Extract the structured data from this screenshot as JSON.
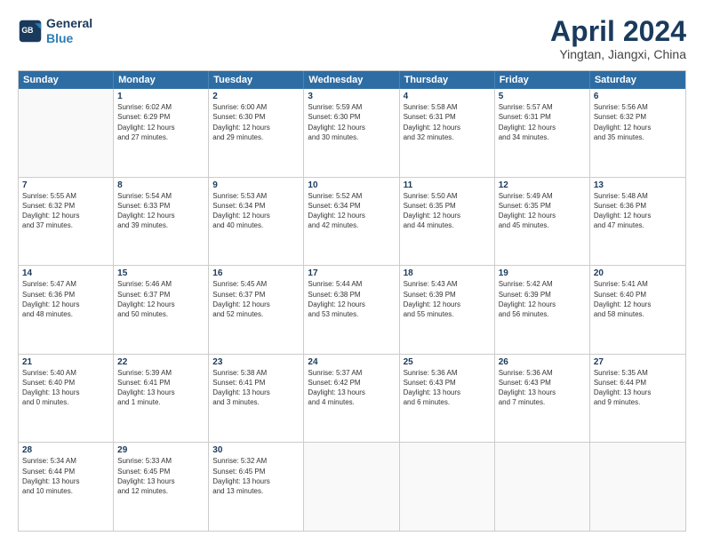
{
  "logo": {
    "line1": "General",
    "line2": "Blue"
  },
  "title": "April 2024",
  "subtitle": "Yingtan, Jiangxi, China",
  "header_days": [
    "Sunday",
    "Monday",
    "Tuesday",
    "Wednesday",
    "Thursday",
    "Friday",
    "Saturday"
  ],
  "weeks": [
    [
      {
        "day": "",
        "info": ""
      },
      {
        "day": "1",
        "info": "Sunrise: 6:02 AM\nSunset: 6:29 PM\nDaylight: 12 hours\nand 27 minutes."
      },
      {
        "day": "2",
        "info": "Sunrise: 6:00 AM\nSunset: 6:30 PM\nDaylight: 12 hours\nand 29 minutes."
      },
      {
        "day": "3",
        "info": "Sunrise: 5:59 AM\nSunset: 6:30 PM\nDaylight: 12 hours\nand 30 minutes."
      },
      {
        "day": "4",
        "info": "Sunrise: 5:58 AM\nSunset: 6:31 PM\nDaylight: 12 hours\nand 32 minutes."
      },
      {
        "day": "5",
        "info": "Sunrise: 5:57 AM\nSunset: 6:31 PM\nDaylight: 12 hours\nand 34 minutes."
      },
      {
        "day": "6",
        "info": "Sunrise: 5:56 AM\nSunset: 6:32 PM\nDaylight: 12 hours\nand 35 minutes."
      }
    ],
    [
      {
        "day": "7",
        "info": "Sunrise: 5:55 AM\nSunset: 6:32 PM\nDaylight: 12 hours\nand 37 minutes."
      },
      {
        "day": "8",
        "info": "Sunrise: 5:54 AM\nSunset: 6:33 PM\nDaylight: 12 hours\nand 39 minutes."
      },
      {
        "day": "9",
        "info": "Sunrise: 5:53 AM\nSunset: 6:34 PM\nDaylight: 12 hours\nand 40 minutes."
      },
      {
        "day": "10",
        "info": "Sunrise: 5:52 AM\nSunset: 6:34 PM\nDaylight: 12 hours\nand 42 minutes."
      },
      {
        "day": "11",
        "info": "Sunrise: 5:50 AM\nSunset: 6:35 PM\nDaylight: 12 hours\nand 44 minutes."
      },
      {
        "day": "12",
        "info": "Sunrise: 5:49 AM\nSunset: 6:35 PM\nDaylight: 12 hours\nand 45 minutes."
      },
      {
        "day": "13",
        "info": "Sunrise: 5:48 AM\nSunset: 6:36 PM\nDaylight: 12 hours\nand 47 minutes."
      }
    ],
    [
      {
        "day": "14",
        "info": "Sunrise: 5:47 AM\nSunset: 6:36 PM\nDaylight: 12 hours\nand 48 minutes."
      },
      {
        "day": "15",
        "info": "Sunrise: 5:46 AM\nSunset: 6:37 PM\nDaylight: 12 hours\nand 50 minutes."
      },
      {
        "day": "16",
        "info": "Sunrise: 5:45 AM\nSunset: 6:37 PM\nDaylight: 12 hours\nand 52 minutes."
      },
      {
        "day": "17",
        "info": "Sunrise: 5:44 AM\nSunset: 6:38 PM\nDaylight: 12 hours\nand 53 minutes."
      },
      {
        "day": "18",
        "info": "Sunrise: 5:43 AM\nSunset: 6:39 PM\nDaylight: 12 hours\nand 55 minutes."
      },
      {
        "day": "19",
        "info": "Sunrise: 5:42 AM\nSunset: 6:39 PM\nDaylight: 12 hours\nand 56 minutes."
      },
      {
        "day": "20",
        "info": "Sunrise: 5:41 AM\nSunset: 6:40 PM\nDaylight: 12 hours\nand 58 minutes."
      }
    ],
    [
      {
        "day": "21",
        "info": "Sunrise: 5:40 AM\nSunset: 6:40 PM\nDaylight: 13 hours\nand 0 minutes."
      },
      {
        "day": "22",
        "info": "Sunrise: 5:39 AM\nSunset: 6:41 PM\nDaylight: 13 hours\nand 1 minute."
      },
      {
        "day": "23",
        "info": "Sunrise: 5:38 AM\nSunset: 6:41 PM\nDaylight: 13 hours\nand 3 minutes."
      },
      {
        "day": "24",
        "info": "Sunrise: 5:37 AM\nSunset: 6:42 PM\nDaylight: 13 hours\nand 4 minutes."
      },
      {
        "day": "25",
        "info": "Sunrise: 5:36 AM\nSunset: 6:43 PM\nDaylight: 13 hours\nand 6 minutes."
      },
      {
        "day": "26",
        "info": "Sunrise: 5:36 AM\nSunset: 6:43 PM\nDaylight: 13 hours\nand 7 minutes."
      },
      {
        "day": "27",
        "info": "Sunrise: 5:35 AM\nSunset: 6:44 PM\nDaylight: 13 hours\nand 9 minutes."
      }
    ],
    [
      {
        "day": "28",
        "info": "Sunrise: 5:34 AM\nSunset: 6:44 PM\nDaylight: 13 hours\nand 10 minutes."
      },
      {
        "day": "29",
        "info": "Sunrise: 5:33 AM\nSunset: 6:45 PM\nDaylight: 13 hours\nand 12 minutes."
      },
      {
        "day": "30",
        "info": "Sunrise: 5:32 AM\nSunset: 6:45 PM\nDaylight: 13 hours\nand 13 minutes."
      },
      {
        "day": "",
        "info": ""
      },
      {
        "day": "",
        "info": ""
      },
      {
        "day": "",
        "info": ""
      },
      {
        "day": "",
        "info": ""
      }
    ]
  ]
}
